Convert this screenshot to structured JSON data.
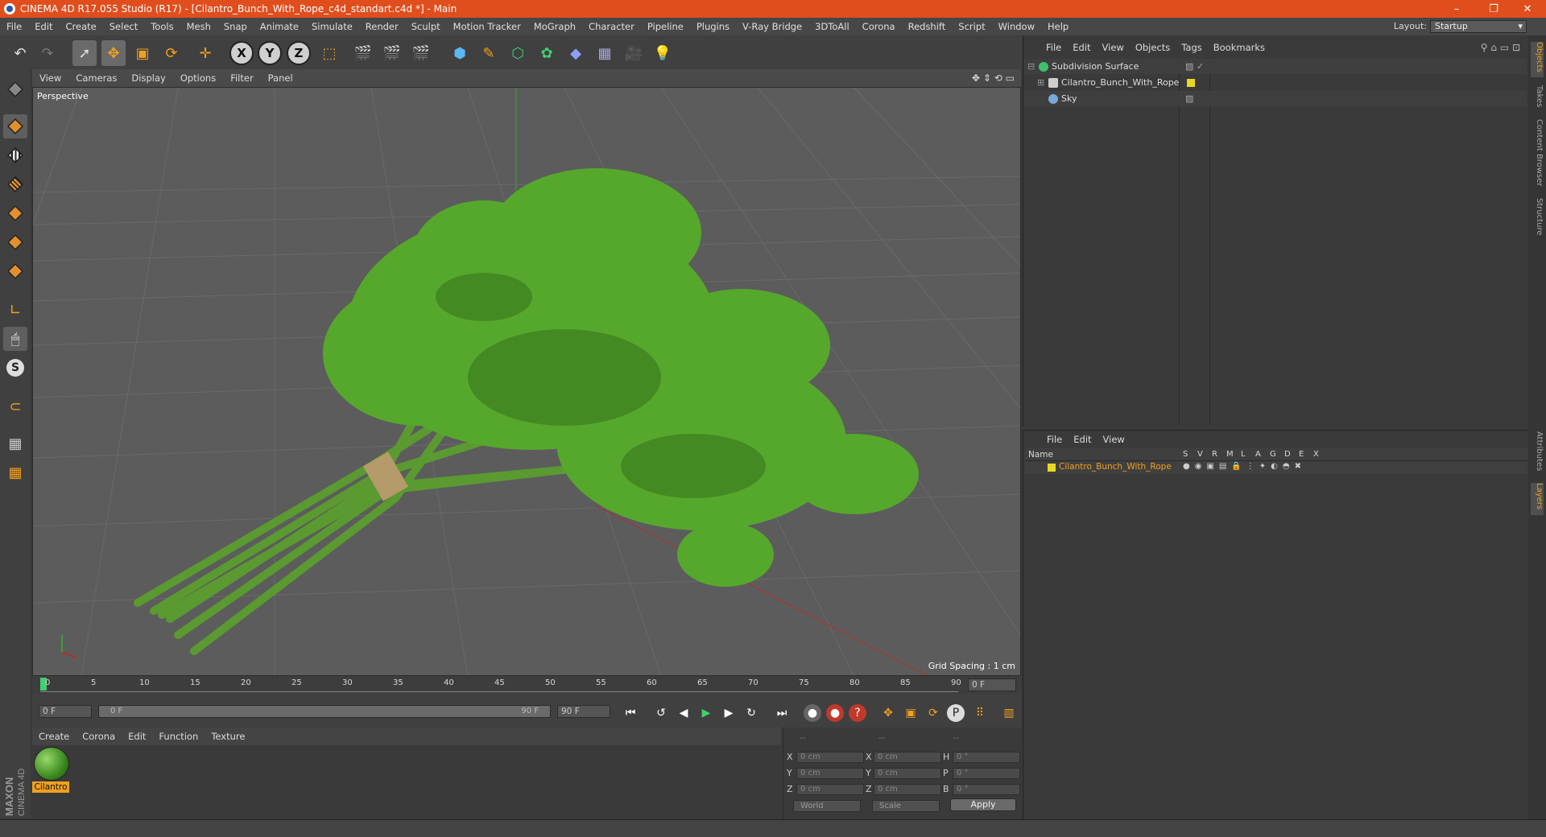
{
  "window": {
    "title": "CINEMA 4D R17.055 Studio (R17) - [Cilantro_Bunch_With_Rope_c4d_standart.c4d *] - Main",
    "minimize": "–",
    "maximize": "❐",
    "close": "✕"
  },
  "menu": [
    "File",
    "Edit",
    "Create",
    "Select",
    "Tools",
    "Mesh",
    "Snap",
    "Animate",
    "Simulate",
    "Render",
    "Sculpt",
    "Motion Tracker",
    "MoGraph",
    "Character",
    "Pipeline",
    "Plugins",
    "V-Ray Bridge",
    "3DToAll",
    "Corona",
    "Redshift",
    "Script",
    "Window",
    "Help"
  ],
  "layout": {
    "label": "Layout:",
    "value": "Startup"
  },
  "toolbar": {
    "axis_x": "X",
    "axis_y": "Y",
    "axis_z": "Z"
  },
  "viewport": {
    "menu": [
      "View",
      "Cameras",
      "Display",
      "Options",
      "Filter",
      "Panel"
    ],
    "label": "Perspective",
    "grid": "Grid Spacing : 1 cm"
  },
  "timeline": {
    "ticks": [
      "0",
      "5",
      "10",
      "15",
      "20",
      "25",
      "30",
      "35",
      "40",
      "45",
      "50",
      "55",
      "60",
      "65",
      "70",
      "75",
      "80",
      "85",
      "90"
    ],
    "current": "0 F"
  },
  "transport": {
    "start": "0 F",
    "slider_start": "0 F",
    "slider_end": "90 F",
    "end": "90 F"
  },
  "materials": {
    "menu": [
      "Create",
      "Corona",
      "Edit",
      "Function",
      "Texture"
    ],
    "item": "Cilantro"
  },
  "coords": {
    "header": [
      "--",
      "--",
      "--"
    ],
    "rows": [
      {
        "a": "X",
        "v1": "0 cm",
        "b": "X",
        "v2": "0 cm",
        "c": "H",
        "v3": "0 °"
      },
      {
        "a": "Y",
        "v1": "0 cm",
        "b": "Y",
        "v2": "0 cm",
        "c": "P",
        "v3": "0 °"
      },
      {
        "a": "Z",
        "v1": "0 cm",
        "b": "Z",
        "v2": "0 cm",
        "c": "B",
        "v3": "0 °"
      }
    ],
    "world": "World",
    "scale": "Scale",
    "apply": "Apply"
  },
  "objects": {
    "menu": [
      "File",
      "Edit",
      "View",
      "Objects",
      "Tags",
      "Bookmarks"
    ],
    "items": [
      {
        "name": "Subdivision Surface",
        "color": "#3fbf6a"
      },
      {
        "name": "Cilantro_Bunch_With_Rope",
        "color": "#cfcfcf"
      },
      {
        "name": "Sky",
        "color": "#7aa8d8"
      }
    ]
  },
  "layers": {
    "menu": [
      "File",
      "Edit",
      "View"
    ],
    "name_col": "Name",
    "cols": [
      "S",
      "V",
      "R",
      "M",
      "L",
      "A",
      "G",
      "D",
      "E",
      "X"
    ],
    "item": "Cilantro_Bunch_With_Rope",
    "item_color": "#f0a020"
  },
  "sidetabs": [
    "Objects",
    "Takes",
    "Content Browser",
    "Structure",
    "Attributes",
    "Layers"
  ],
  "brand": {
    "line1": "MAXON",
    "line2": "CINEMA 4D"
  }
}
